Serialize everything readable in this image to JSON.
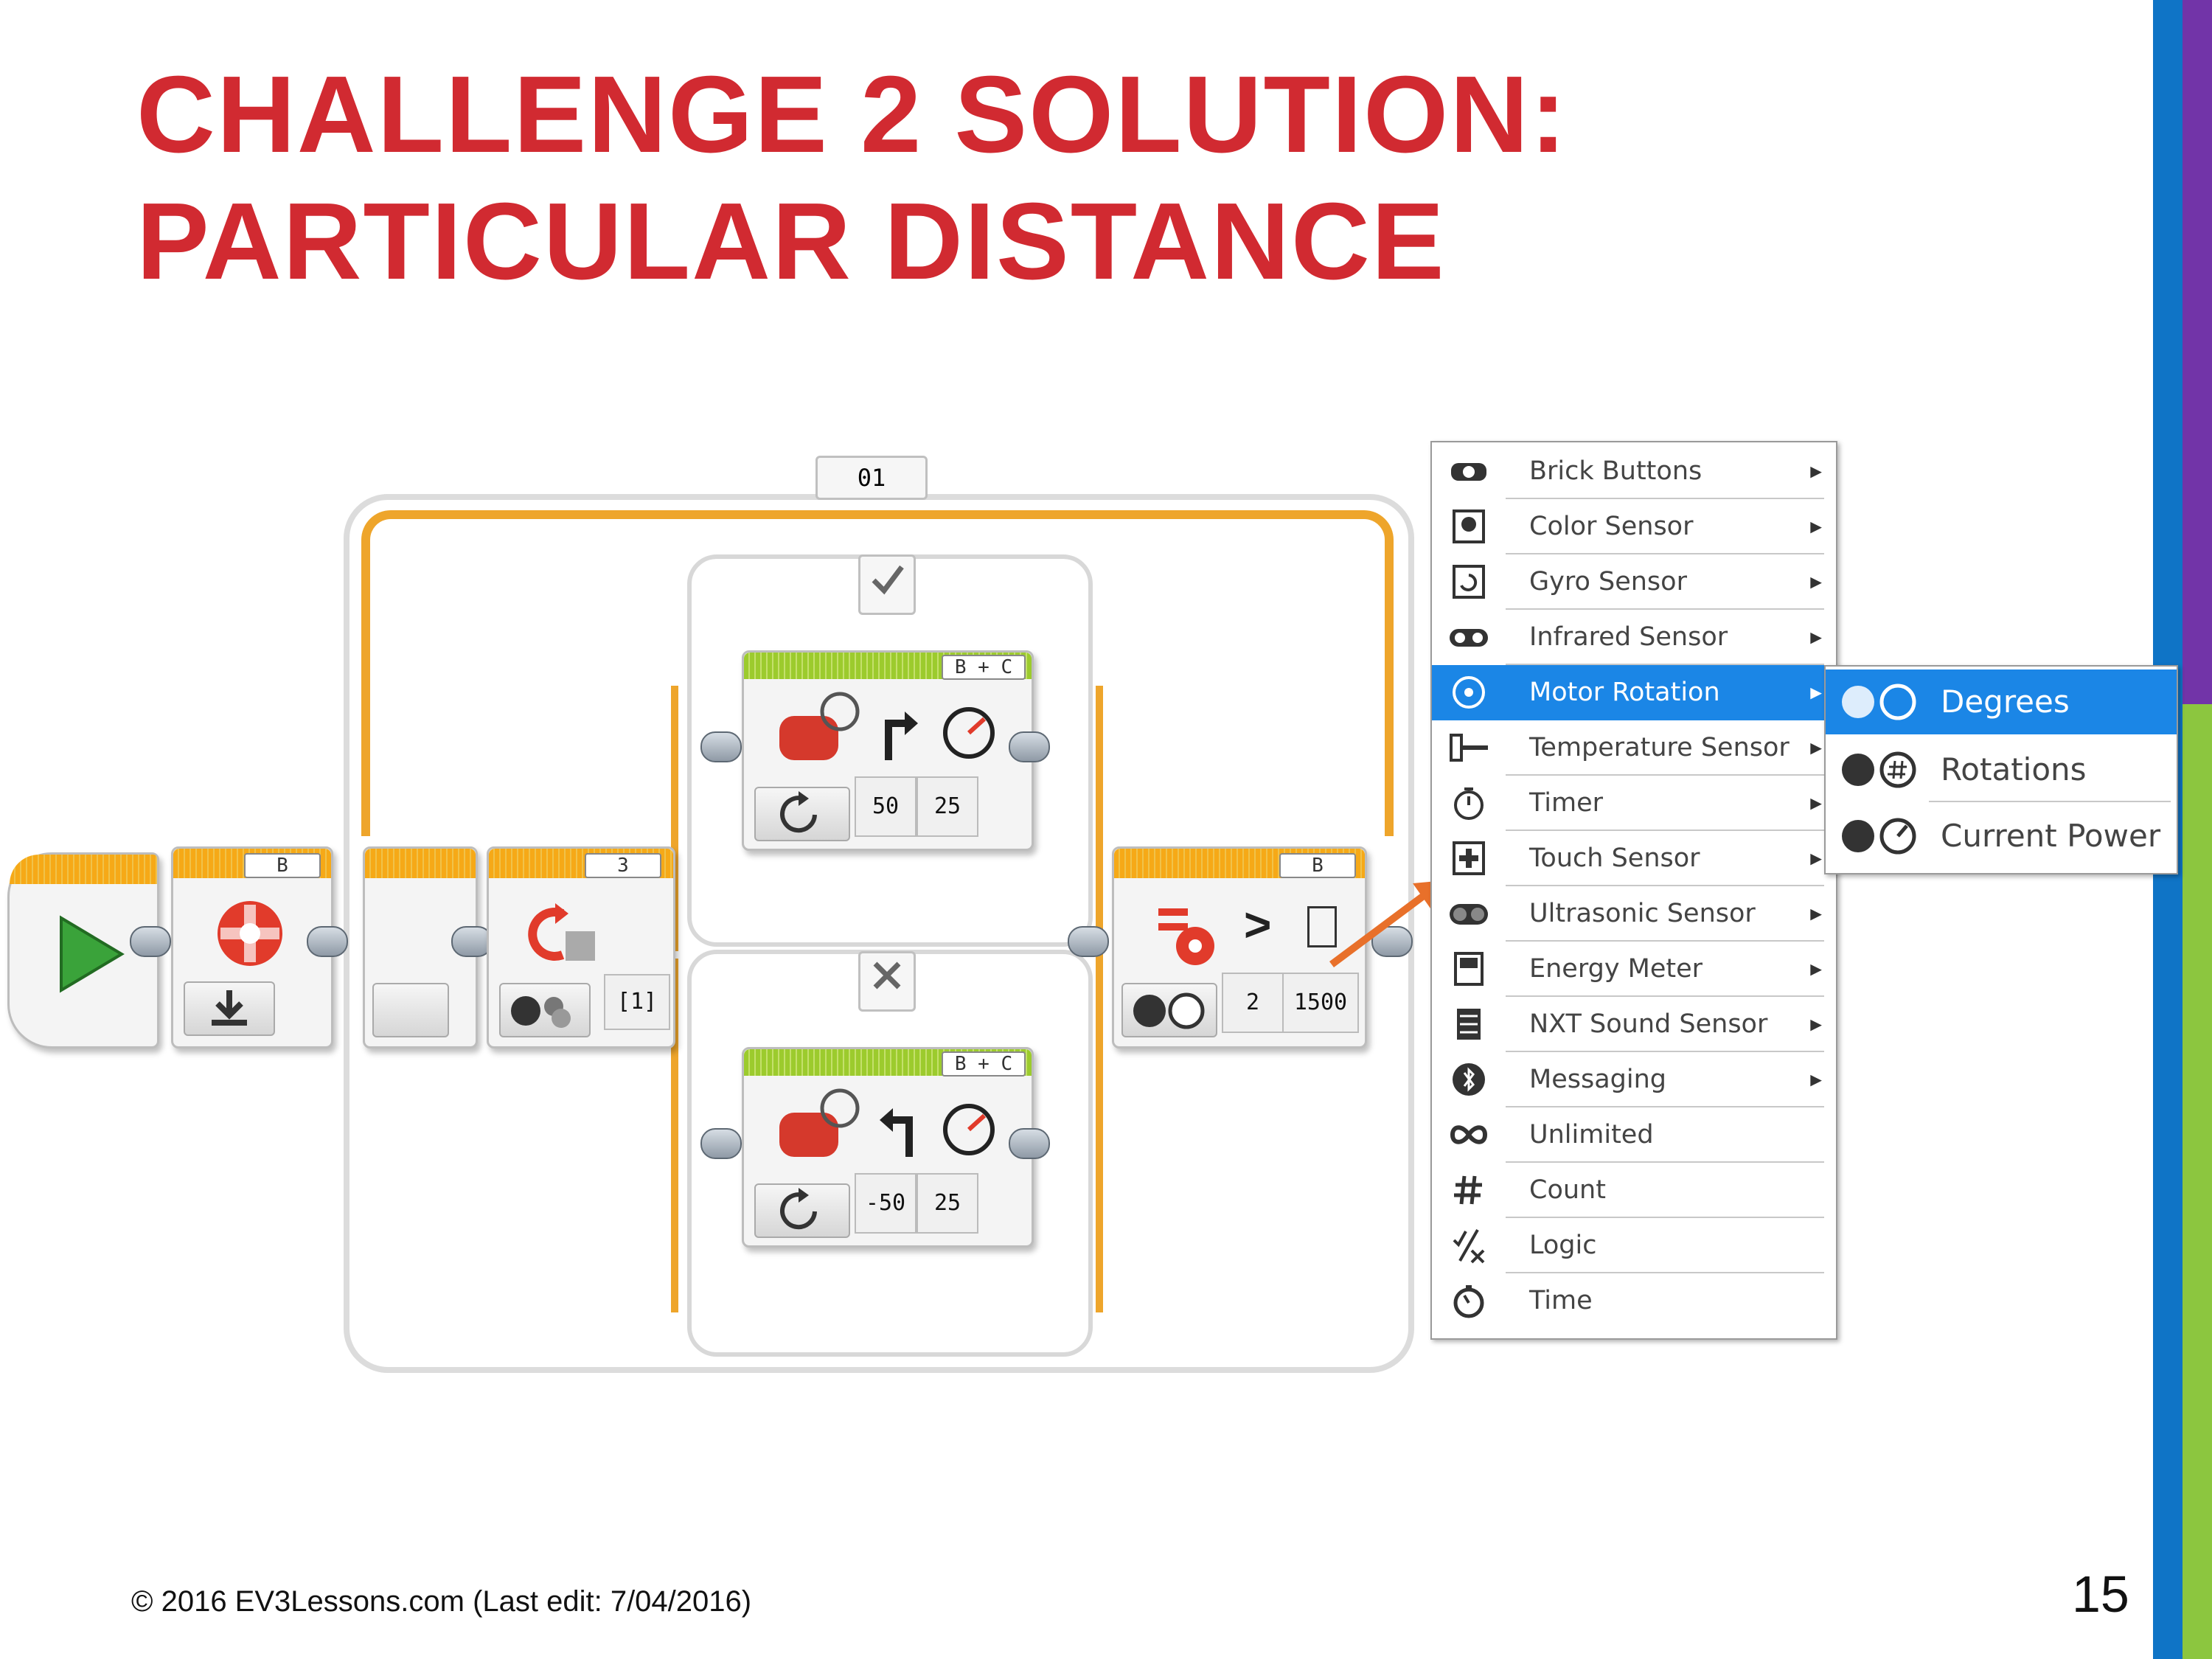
{
  "slide": {
    "title_line1": "CHALLENGE 2 SOLUTION:",
    "title_line2": "PARTICULAR DISTANCE",
    "footer": "© 2016 EV3Lessons.com (Last edit: 7/04/2016)",
    "page_number": "15"
  },
  "colors": {
    "title": "#d12a31",
    "stripe_blue": "#0f74c6",
    "stripe_purple": "#7234a8",
    "stripe_green": "#8cc63f",
    "menu_selected": "#1b86e6",
    "loop_orange": "#eea52b"
  },
  "program": {
    "loop_label": "01",
    "reset_block_port": "B",
    "color_block_port": "3",
    "color_block_value": "[1]",
    "true_case_icon": "checkmark-icon",
    "false_case_icon": "x-icon",
    "steer_true": {
      "ports": "B + C",
      "steering": "50",
      "power": "25"
    },
    "steer_false": {
      "ports": "B + C",
      "steering": "-50",
      "power": "25"
    },
    "wait_block": {
      "port": "B",
      "compare": ">",
      "mode_value": "2",
      "threshold": "1500"
    }
  },
  "menu": {
    "items": [
      {
        "label": "Brick Buttons",
        "icon": "brick-buttons-icon",
        "submenu": true
      },
      {
        "label": "Color Sensor",
        "icon": "color-sensor-icon",
        "submenu": true
      },
      {
        "label": "Gyro Sensor",
        "icon": "gyro-sensor-icon",
        "submenu": true
      },
      {
        "label": "Infrared Sensor",
        "icon": "infrared-sensor-icon",
        "submenu": true
      },
      {
        "label": "Motor Rotation",
        "icon": "motor-rotation-icon",
        "submenu": true,
        "selected": true
      },
      {
        "label": "Temperature Sensor",
        "icon": "temperature-sensor-icon",
        "submenu": true
      },
      {
        "label": "Timer",
        "icon": "timer-icon",
        "submenu": true
      },
      {
        "label": "Touch Sensor",
        "icon": "touch-sensor-icon",
        "submenu": true
      },
      {
        "label": "Ultrasonic Sensor",
        "icon": "ultrasonic-sensor-icon",
        "submenu": true
      },
      {
        "label": "Energy Meter",
        "icon": "energy-meter-icon",
        "submenu": true
      },
      {
        "label": "NXT Sound Sensor",
        "icon": "sound-sensor-icon",
        "submenu": true
      },
      {
        "label": "Messaging",
        "icon": "bluetooth-icon",
        "submenu": true
      },
      {
        "label": "Unlimited",
        "icon": "infinity-icon",
        "submenu": false
      },
      {
        "label": "Count",
        "icon": "hash-icon",
        "submenu": false
      },
      {
        "label": "Logic",
        "icon": "logic-icon",
        "submenu": false
      },
      {
        "label": "Time",
        "icon": "stopwatch-icon",
        "submenu": false
      }
    ],
    "submenu": [
      {
        "label": "Degrees",
        "icon": "degrees-icon",
        "selected": true
      },
      {
        "label": "Rotations",
        "icon": "rotations-icon"
      },
      {
        "label": "Current Power",
        "icon": "current-power-icon"
      }
    ]
  }
}
